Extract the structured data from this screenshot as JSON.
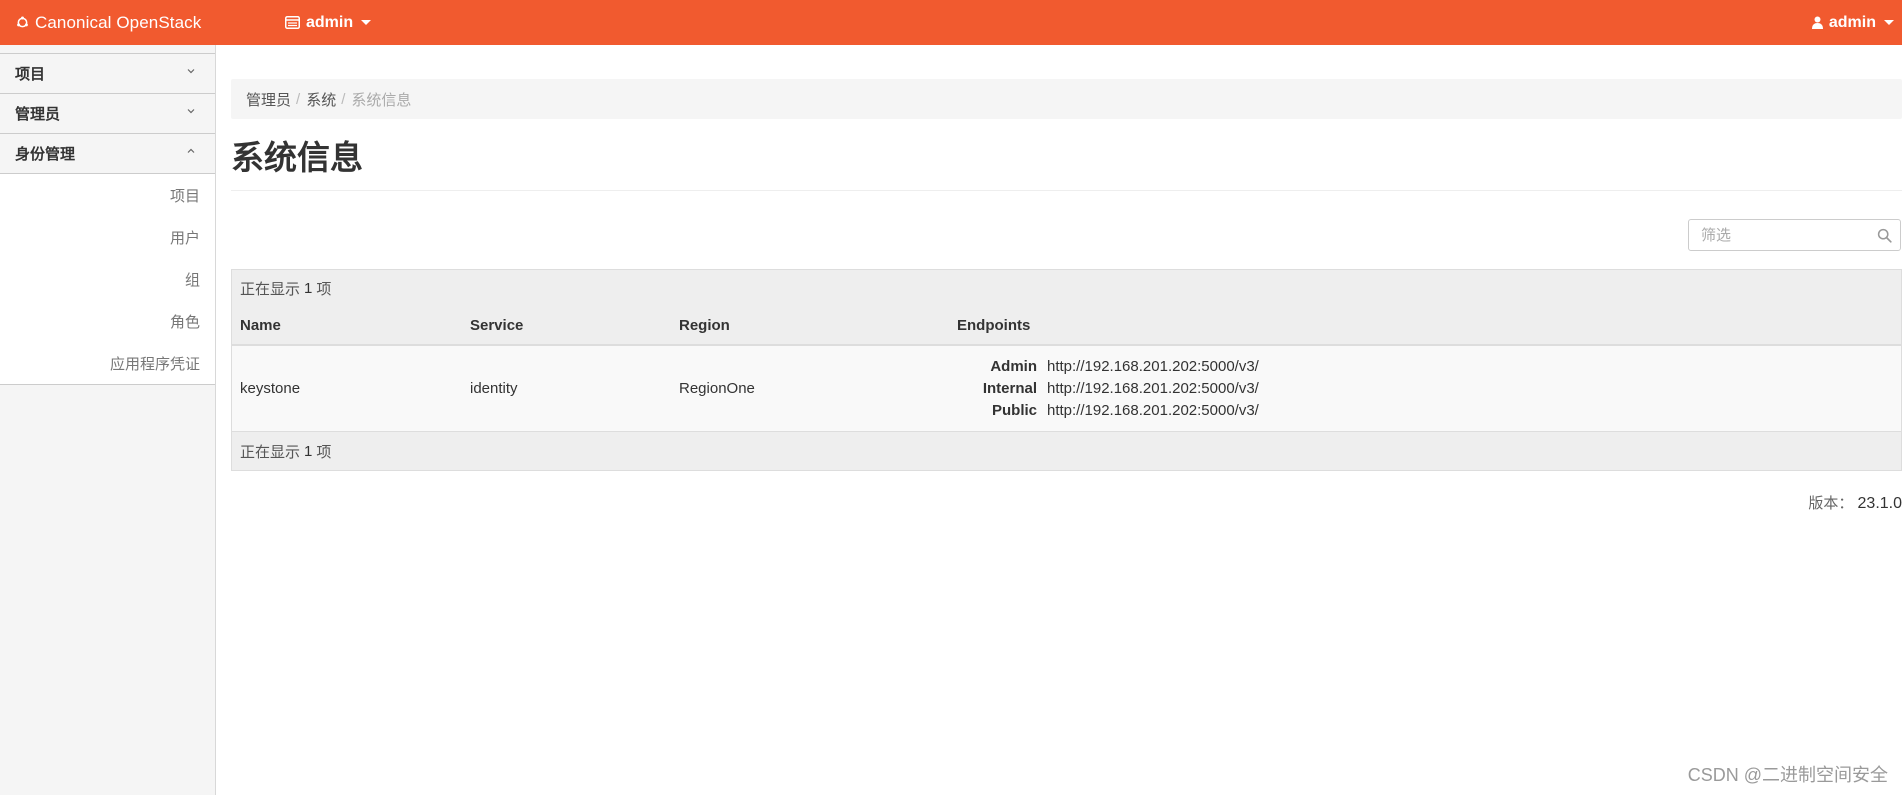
{
  "topbar": {
    "brand": "Canonical OpenStack",
    "project": "admin",
    "user": "admin"
  },
  "sidebar": {
    "groups": [
      {
        "label": "项目"
      },
      {
        "label": "管理员"
      },
      {
        "label": "身份管理"
      }
    ],
    "identity_items": [
      {
        "label": "项目"
      },
      {
        "label": "用户"
      },
      {
        "label": "组"
      },
      {
        "label": "角色"
      },
      {
        "label": "应用程序凭证"
      }
    ]
  },
  "breadcrumb": {
    "items": [
      "管理员",
      "系统"
    ],
    "separator": "/",
    "active": "系统信息"
  },
  "page": {
    "title": "系统信息"
  },
  "filter": {
    "placeholder": "筛选"
  },
  "table": {
    "count_prefix": "正在显示",
    "count": "1",
    "count_suffix": "项",
    "columns": {
      "name": "Name",
      "service": "Service",
      "region": "Region",
      "endpoints": "Endpoints"
    },
    "rows": [
      {
        "name": "keystone",
        "service": "identity",
        "region": "RegionOne",
        "endpoints": [
          {
            "type": "Admin",
            "url": "http://192.168.201.202:5000/v3/"
          },
          {
            "type": "Internal",
            "url": "http://192.168.201.202:5000/v3/"
          },
          {
            "type": "Public",
            "url": "http://192.168.201.202:5000/v3/"
          }
        ]
      }
    ]
  },
  "version": {
    "label": "版本：",
    "value": "23.1.0"
  },
  "watermark": "CSDN @二进制空间安全",
  "colors": {
    "brand_orange": "#f15a2f",
    "sidebar_bg": "#f5f5f5",
    "table_header_bg": "#eeeeee"
  }
}
